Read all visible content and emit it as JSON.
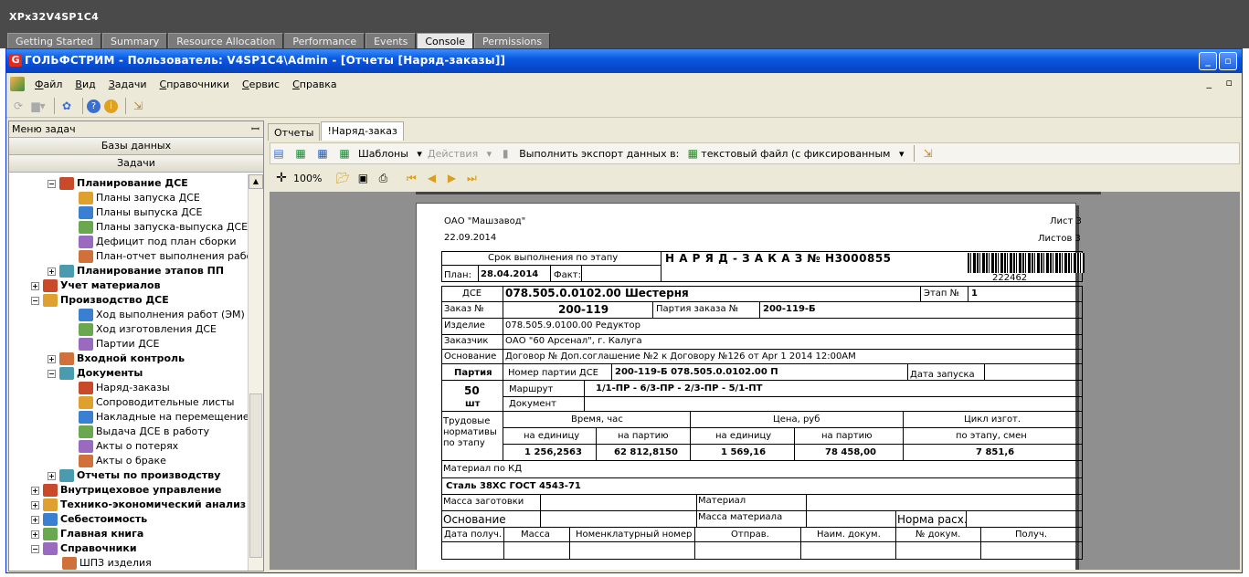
{
  "host": {
    "title": "XPx32V4SP1C4",
    "tabs": [
      "Getting Started",
      "Summary",
      "Resource Allocation",
      "Performance",
      "Events",
      "Console",
      "Permissions"
    ],
    "active_tab": "Console"
  },
  "app": {
    "logo": "G",
    "title": "ГОЛЬФСТРИМ - Пользователь: V4SP1C4\\Admin - [Отчеты  [Наряд-заказы]]",
    "menu": [
      "Файл",
      "Вид",
      "Задачи",
      "Справочники",
      "Сервис",
      "Справка"
    ],
    "mdi_controls": "_ ▫"
  },
  "left_panel": {
    "header": "Меню задач",
    "buttons": [
      "Базы данных",
      "Задачи"
    ],
    "tree": [
      {
        "label": "Планирование ДСЕ",
        "bold": true,
        "expander": "−"
      },
      {
        "label": "Планы запуска ДСЕ"
      },
      {
        "label": "Планы выпуска ДСЕ"
      },
      {
        "label": "Планы запуска-выпуска ДСЕ"
      },
      {
        "label": "Дефицит под план сборки"
      },
      {
        "label": "План-отчет выполнения работ"
      },
      {
        "label": "Планирование этапов ПП",
        "bold": true,
        "expander": "+"
      },
      {
        "label": "Учет материалов",
        "bold": true,
        "expander": "+"
      },
      {
        "label": "Производство ДСЕ",
        "bold": true,
        "expander": "−"
      },
      {
        "label": "Ход выполнения работ (ЭМ)"
      },
      {
        "label": "Ход изготовления ДСЕ"
      },
      {
        "label": "Партии ДСЕ"
      },
      {
        "label": "Входной контроль",
        "bold": true,
        "expander": "+"
      },
      {
        "label": "Документы",
        "bold": true,
        "expander": "−"
      },
      {
        "label": "Наряд-заказы"
      },
      {
        "label": "Сопроводительные листы"
      },
      {
        "label": "Накладные на перемещение ДС"
      },
      {
        "label": "Выдача ДСЕ в работу"
      },
      {
        "label": "Акты о потерях"
      },
      {
        "label": "Акты о браке"
      },
      {
        "label": "Отчеты по производству",
        "bold": true,
        "expander": "+"
      },
      {
        "label": "Внутрицеховое управление",
        "bold": true,
        "expander": "+"
      },
      {
        "label": "Технико-экономический анализ",
        "bold": true,
        "expander": "+"
      },
      {
        "label": "Себестоимость",
        "bold": true,
        "expander": "+"
      },
      {
        "label": "Главная книга",
        "bold": true,
        "expander": "+"
      },
      {
        "label": "Справочники",
        "bold": true,
        "expander": "−"
      },
      {
        "label": "ШПЗ изделия"
      }
    ]
  },
  "doc": {
    "tabs": [
      "Отчеты",
      "!Наряд-заказ"
    ],
    "toolbar": {
      "templates": "Шаблоны",
      "actions": "Действия",
      "export_label": "Выполнить экспорт данных в:",
      "export_target": "текстовый файл (с фиксированным"
    },
    "zoom": "100%"
  },
  "report": {
    "company": "ОАО \"Машзавод\"",
    "date": "22.09.2014",
    "sheet": "Лист 3",
    "sheets": "Листов 3",
    "stage_deadline": "Срок выполнения по этапу",
    "title": "Н А Р Я Д  -  З А К А З  № Н3000855",
    "barcode_number": "222462",
    "plan_label": "План:",
    "plan_date": "28.04.2014",
    "fact_label": "Факт:",
    "dse_label": "ДСЕ",
    "dse_value": "078.505.0.0102.00 Шестерня",
    "stage_label": "Этап №",
    "stage_value": "1",
    "order_label": "Заказ №",
    "order_value": "200-119",
    "batch_order_label": "Партия заказа №",
    "batch_order_value": "200-119-Б",
    "product_label": "Изделие",
    "product_value": "078.505.9.0100.00 Редуктор",
    "customer_label": "Заказчик",
    "customer_value": "ОАО \"60 Арсенал\", г. Калуга",
    "basis_label": "Основание",
    "basis_value": "Договор № Доп.соглашение №2 к Договору №126 от Apr  1 2014 12:00AM",
    "batch_label": "Партия",
    "batch_count": "50",
    "batch_unit": "шт",
    "batch_num_label": "Номер партии ДСЕ",
    "batch_num_value": "200-119-Б 078.505.0.0102.00 П",
    "start_date_label": "Дата запуска",
    "route_label": "Маршрут",
    "route_value": "1/1-ПР - 6/3-ПР - 2/3-ПР - 5/1-ПТ",
    "document_label": "Документ",
    "labor_label": "Трудовые нормативы по этапу",
    "time_label": "Время, час",
    "price_label": "Цена, руб",
    "cycle_label": "Цикл изгот.",
    "per_unit": "на единицу",
    "per_batch": "на партию",
    "per_stage": "по этапу, смен",
    "time_unit": "1 256,2563",
    "time_batch": "62 812,8150",
    "price_unit": "1 569,16",
    "price_batch": "78 458,00",
    "cycle_value": "7 851,6",
    "material_kd_label": "Материал по КД",
    "material_kd_value": "Сталь 38ХС ГОСТ 4543-71",
    "blank_mass_label": "Масса заготовки",
    "material_label": "Материал",
    "basis2_label": "Основание",
    "material_mass_label": "Масса материала",
    "norm_label": "Норма расх.",
    "cols": [
      "Дата получ.",
      "Масса",
      "Номенклатурный номер",
      "Отправ.",
      "Наим. докум.",
      "№ докум.",
      "Получ."
    ]
  }
}
